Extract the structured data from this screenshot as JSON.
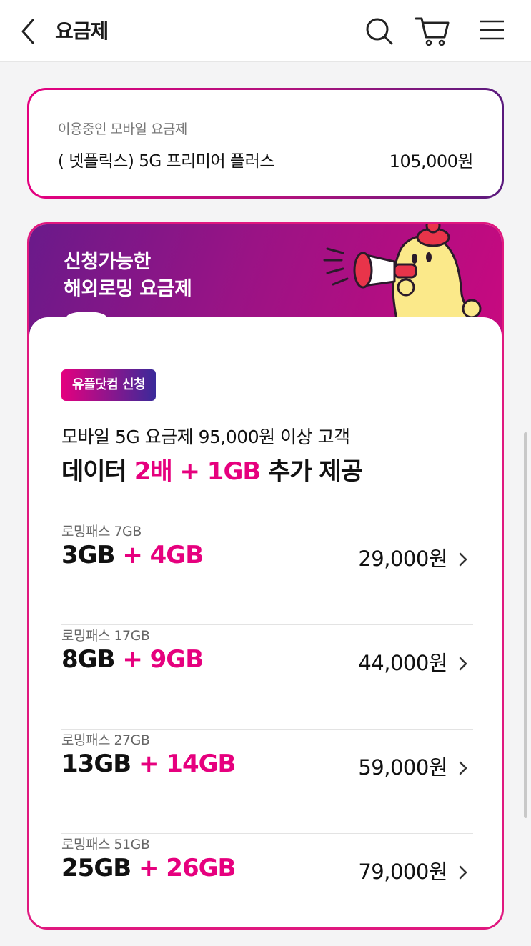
{
  "header": {
    "title": "요금제",
    "icons": [
      "back-icon",
      "search-icon",
      "cart-icon",
      "menu-icon"
    ]
  },
  "current_plan": {
    "label": "이용중인 모바일 요금제",
    "name": "( 넷플릭스) 5G 프리미어 플러스",
    "price": "105,000원"
  },
  "roaming": {
    "banner_line1": "신청가능한",
    "banner_line2": "해외로밍 요금제",
    "badge": "유플닷컴 신청",
    "promo_line1": "모바일 5G 요금제 95,000원 이상 고객",
    "promo_line2_a": "데이터 ",
    "promo_line2_b": "2배 + 1GB",
    "promo_line2_c": " 추가 제공",
    "plans": [
      {
        "name": "로밍패스 7GB",
        "base": "3GB",
        "plus": "+ 4GB",
        "price": "29,000원"
      },
      {
        "name": "로밍패스 17GB",
        "base": "8GB",
        "plus": "+ 9GB",
        "price": "44,000원"
      },
      {
        "name": "로밍패스 27GB",
        "base": "13GB",
        "plus": "+ 14GB",
        "price": "59,000원"
      },
      {
        "name": "로밍패스 51GB",
        "base": "25GB",
        "plus": "+ 26GB",
        "price": "79,000원"
      }
    ]
  },
  "colors": {
    "accent": "#e6007e",
    "purple": "#6a1a8a"
  }
}
